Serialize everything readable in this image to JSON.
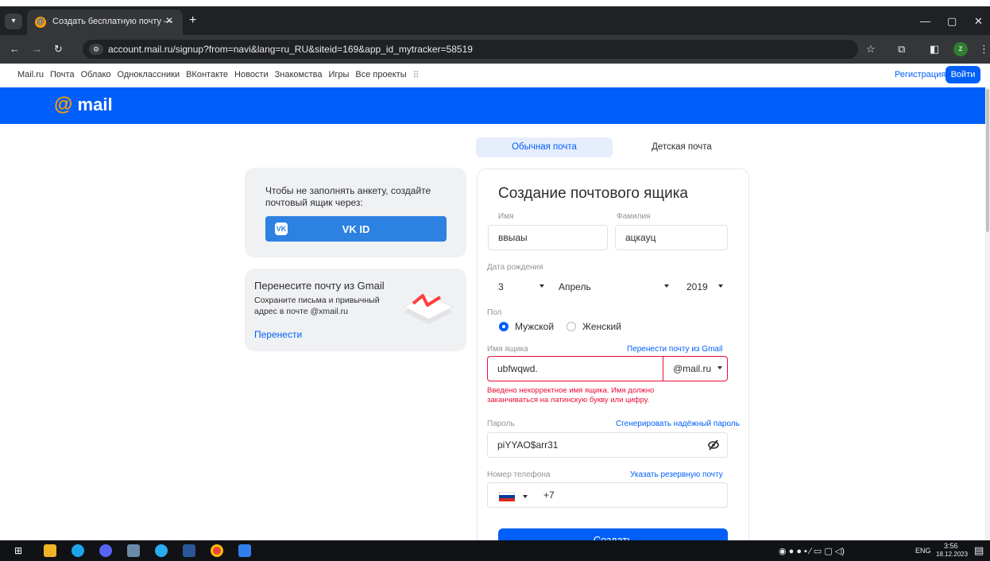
{
  "browser": {
    "tab_title": "Создать бесплатную почту —",
    "tab_close": "✕",
    "new_tab": "+",
    "url": "account.mail.ru/signup?from=navi&lang=ru_RU&siteid=169&app_id_mytracker=58519",
    "profile_initial": "z"
  },
  "portal": {
    "links": [
      "Mail.ru",
      "Почта",
      "Облако",
      "Одноклассники",
      "ВКонтакте",
      "Новости",
      "Знакомства",
      "Игры",
      "Все проекты"
    ],
    "register": "Регистрация",
    "login": "Войти"
  },
  "header": {
    "logo_at": "@",
    "logo_text": "mail"
  },
  "vk_card": {
    "text": "Чтобы не заполнять анкету, создайте почтовый ящик через:",
    "button": "VK ID",
    "logo": "VK"
  },
  "gmail_card": {
    "title": "Перенесите почту из Gmail",
    "subtitle": "Сохраните письма и привычный адрес в почте @xmail.ru",
    "link": "Перенести"
  },
  "tabs": {
    "regular": "Обычная почта",
    "child": "Детская почта"
  },
  "form": {
    "title": "Создание почтового ящика",
    "first_name_label": "Имя",
    "first_name_value": "ввыаы",
    "last_name_label": "Фамилия",
    "last_name_value": "ацкауц",
    "birth_label": "Дата рождения",
    "birth_day": "3",
    "birth_month": "Апрель",
    "birth_year": "2019",
    "gender_label": "Пол",
    "gender_male": "Мужской",
    "gender_female": "Женский",
    "mailbox_label": "Имя ящика",
    "mailbox_link": "Перенести почту из Gmail",
    "mailbox_value": "ubfwqwd.",
    "domain": "@mail.ru",
    "mailbox_error": "Введено некорректное имя ящика. Имя должно заканчиваться на латинскую букву или цифру.",
    "password_label": "Пароль",
    "password_link": "Сгенерировать надёжный пароль",
    "password_value": "piYYAO$arr31",
    "phone_label": "Номер телефона",
    "phone_link": "Указать резервную почту",
    "phone_prefix": "+7",
    "submit": "Создать"
  },
  "taskbar": {
    "lang": "ENG",
    "time": "3:56",
    "date": "18.12.2023"
  }
}
